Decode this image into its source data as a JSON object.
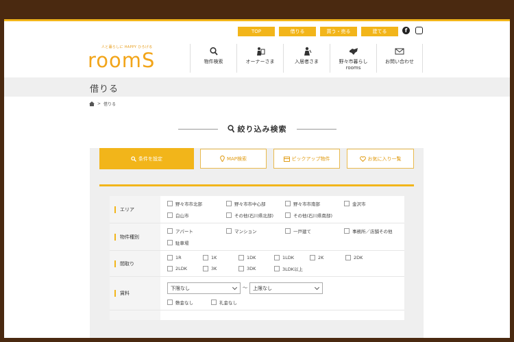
{
  "top_links": [
    "TOP",
    "借りる",
    "買う・売る",
    "建てる"
  ],
  "sns": {
    "facebook": "f",
    "instagram_icon": "instagram-icon"
  },
  "logo": {
    "tagline": "人と暮らしに HAPPY ひろげる",
    "word": "roomS"
  },
  "gnav": [
    {
      "label": "物件検索",
      "icon": "search-icon"
    },
    {
      "label": "オーナーさま",
      "icon": "owner-icon"
    },
    {
      "label": "入居者さま",
      "icon": "resident-icon"
    },
    {
      "label": "野々市暮らし\nrooms",
      "icon": "map-icon"
    },
    {
      "label": "お問い合わせ",
      "icon": "mail-icon"
    }
  ],
  "page_title": "借りる",
  "breadcrumb": {
    "current": "借りる"
  },
  "section_heading": "絞り込み検索",
  "tabs": [
    "条件を設定",
    "MAP検索",
    "ピックアップ物件",
    "お気に入り一覧"
  ],
  "form": {
    "area": {
      "label": "エリア",
      "options": [
        "野々市市北部",
        "野々市市中心部",
        "野々市市南部",
        "金沢市",
        "白山市",
        "その他(石川県北部)",
        "その他(石川県南部)"
      ]
    },
    "type": {
      "label": "物件種別",
      "options": [
        "アパート",
        "マンション",
        "一戸建て",
        "事務所／店舗その他",
        "駐車場"
      ]
    },
    "layout": {
      "label": "間取り",
      "options": [
        "1R",
        "1K",
        "1DK",
        "1LDK",
        "2K",
        "2DK",
        "2LDK",
        "3K",
        "3DK",
        "3LDK以上"
      ]
    },
    "rent": {
      "label": "賃料",
      "min": "下限なし",
      "max": "上限なし",
      "separator": "〜",
      "options": [
        "敷金なし",
        "礼金なし"
      ]
    }
  },
  "colors": {
    "accent": "#f2b51a",
    "frame": "#4a2910"
  }
}
